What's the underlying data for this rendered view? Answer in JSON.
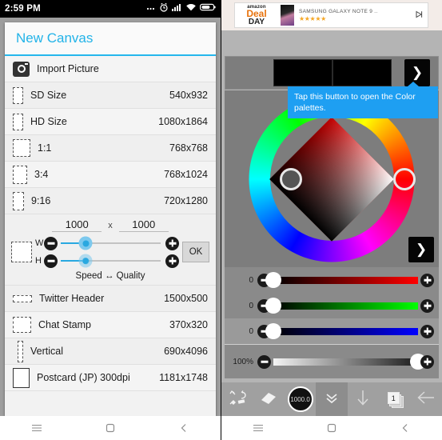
{
  "left_phone": {
    "status_bar": {
      "time": "2:59 PM",
      "icons": [
        "more-dots-icon",
        "alarm-icon",
        "signal-icon",
        "wifi-icon",
        "battery-icon"
      ]
    },
    "dialog": {
      "title": "New Canvas",
      "import": {
        "label": "Import Picture",
        "icon": "camera-icon"
      },
      "presets": [
        {
          "label": "SD Size",
          "value": "540x932"
        },
        {
          "label": "HD Size",
          "value": "1080x1864"
        },
        {
          "label": "1:1",
          "value": "768x768"
        },
        {
          "label": "3:4",
          "value": "768x1024"
        },
        {
          "label": "9:16",
          "value": "720x1280"
        }
      ],
      "custom": {
        "width_value": "1000",
        "height_value": "1000",
        "separator": "x",
        "w_label": "W",
        "h_label": "H",
        "minus_label": "−",
        "plus_label": "+",
        "ok_label": "OK",
        "hint": "Speed ↔ Quality",
        "w_slider_percent": 25,
        "h_slider_percent": 25
      },
      "presets2": [
        {
          "label": "Twitter Header",
          "value": "1500x500"
        },
        {
          "label": "Chat Stamp",
          "value": "370x320"
        },
        {
          "label": "Vertical",
          "value": "690x4096"
        },
        {
          "label": "Postcard (JP) 300dpi",
          "value": "1181x1748"
        }
      ]
    }
  },
  "right_phone": {
    "ad": {
      "brand": "amazon",
      "deal": "Deal",
      "of_the": "of the",
      "day": "DAY",
      "title": "SAMSUNG GALAXY NOTE 9 ..",
      "stars": "★★★★★",
      "close_icon": "ad-info-icon"
    },
    "tooltip": "Tap this button to open the Color palettes.",
    "swatches": {
      "primary_color": "#000000",
      "secondary_color": "#000000",
      "palette_arrow_label": "❯"
    },
    "wheel": {
      "arrow_label": "❯",
      "selected_hue_color": "#c40000"
    },
    "sliders": [
      {
        "name": "red",
        "value": "0",
        "percent": 0,
        "color": "#ff0000"
      },
      {
        "name": "green",
        "value": "0",
        "percent": 0,
        "color": "#00ff00"
      },
      {
        "name": "blue",
        "value": "0",
        "percent": 0,
        "color": "#0000ff"
      },
      {
        "name": "alpha",
        "value": "100%",
        "percent": 100,
        "color": "#1c1c1c"
      }
    ],
    "slider_minus": "−",
    "slider_plus": "+",
    "toolbar": {
      "transform_icon": "transform-icon",
      "eraser_icon": "eraser-icon",
      "brush_size": "1000.0",
      "collapse_icon": "chevron-double-down-icon",
      "download_icon": "down-arrow-icon",
      "layer_count": "1",
      "back_icon": "back-arrow-icon"
    }
  },
  "navbar": {
    "menu_icon": "menu-icon",
    "home_icon": "home-icon",
    "back_icon": "back-icon"
  }
}
